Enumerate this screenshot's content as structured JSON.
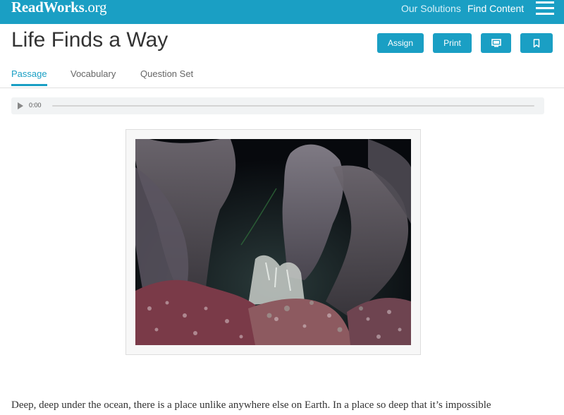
{
  "header": {
    "logo_main": "ReadWorks",
    "logo_tld": ".org",
    "nav": [
      "Our Solutions",
      "Find Content"
    ]
  },
  "article": {
    "title": "Life Finds a Way",
    "actions": {
      "assign": "Assign",
      "print": "Print",
      "present_icon": "monitor-icon",
      "bookmark_icon": "bookmark-icon"
    },
    "tabs": [
      {
        "label": "Passage",
        "active": true
      },
      {
        "label": "Vocabulary",
        "active": false
      },
      {
        "label": "Question Set",
        "active": false
      }
    ]
  },
  "audio": {
    "time": "0:00",
    "play_icon": "play-icon"
  },
  "passage": {
    "first_line": "Deep, deep under the ocean, there is a place unlike anywhere else on Earth. In a place so deep that it’s impossible"
  },
  "colors": {
    "brand": "#1a9fc4",
    "text": "#333333",
    "muted": "#666666"
  }
}
